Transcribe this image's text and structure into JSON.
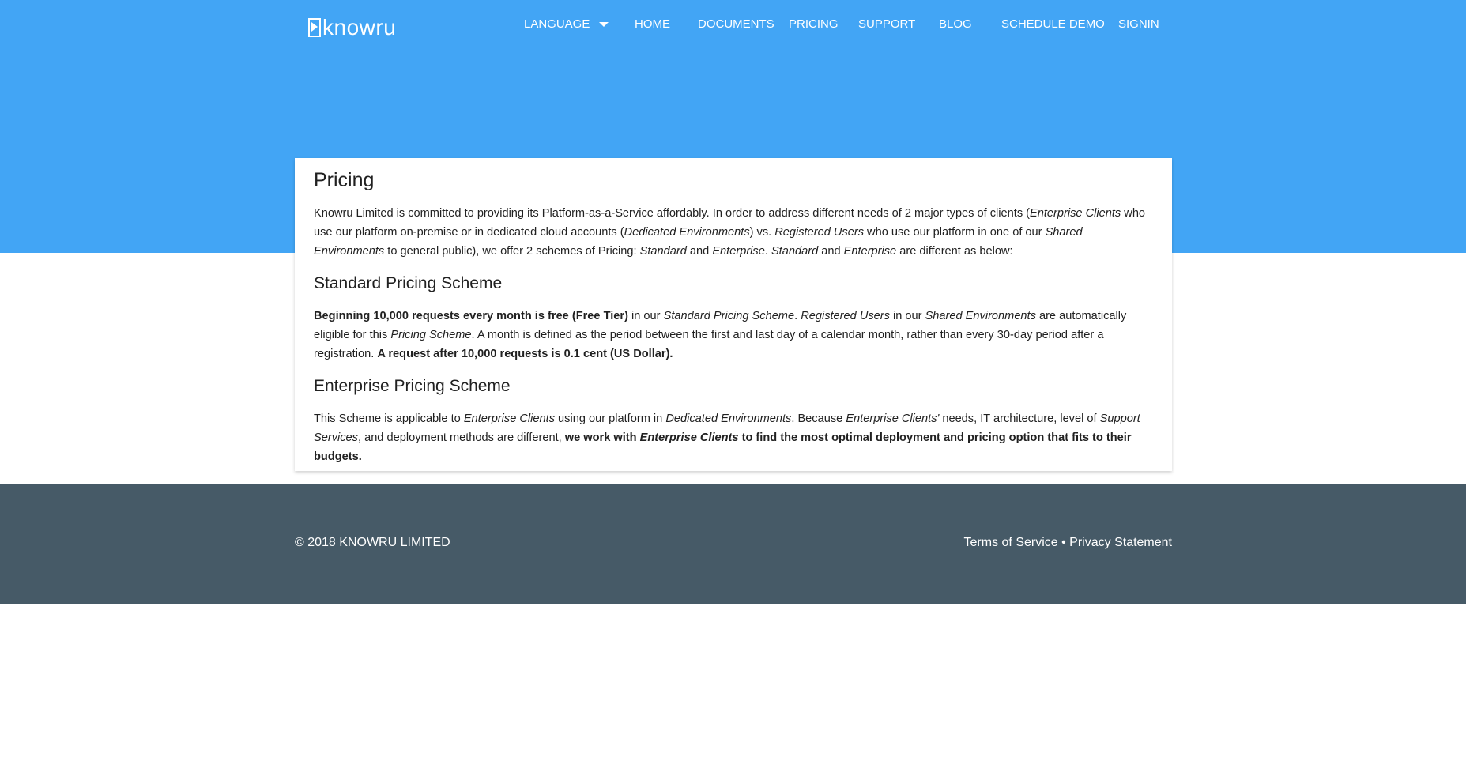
{
  "header": {
    "logo_text": "knowru",
    "nav": {
      "language": "LANGUAGE",
      "home": "HOME",
      "documents": "DOCUMENTS",
      "pricing": "PRICING",
      "support": "SUPPORT",
      "blog": "BLOG",
      "schedule_demo": "SCHEDULE DEMO",
      "signin": "SIGNIN"
    }
  },
  "colors": {
    "hero": "#42a5f5",
    "footer": "#465a67"
  },
  "card": {
    "title": "Pricing",
    "intro": {
      "t1": "Knowru Limited is committed to providing its Platform-as-a-Service affordably. In order to address different needs of 2 major types of clients (",
      "i1": "Enterprise Clients",
      "t2": " who use our platform on-premise or in dedicated cloud accounts (",
      "i2": "Dedicated Environments",
      "t3": ") vs. ",
      "i3": "Registered Users",
      "t4": " who use our platform in one of our ",
      "i4": "Shared Environments",
      "t5": " to general public), we offer 2 schemes of Pricing: ",
      "i5": "Standard",
      "t6": " and ",
      "i6": "Enterprise",
      "t7": ". ",
      "i7": "Standard",
      "t8": " and ",
      "i8": "Enterprise",
      "t9": " are different as below:"
    },
    "standard": {
      "heading": "Standard Pricing Scheme",
      "b1": "Beginning 10,000 requests every month is free (Free Tier)",
      "t1": " in our ",
      "i1": "Standard Pricing Scheme",
      "t2": ". ",
      "i2": "Registered Users",
      "t3": " in our ",
      "i3": "Shared Environments",
      "t4": " are automatically eligible for this ",
      "i4": "Pricing Scheme",
      "t5": ". A month is defined as the period between the first and last day of a calendar month, rather than every 30-day period after a registration. ",
      "b2": "A request after 10,000 requests is 0.1 cent (US Dollar)."
    },
    "enterprise": {
      "heading": "Enterprise Pricing Scheme",
      "t1": "This Scheme is applicable to ",
      "i1": "Enterprise Clients",
      "t2": " using our platform in ",
      "i2": "Dedicated Environments",
      "t3": ". Because ",
      "i3": "Enterprise Clients'",
      "t4": " needs, IT architecture, level of ",
      "i4": "Support Services",
      "t5": ", and deployment methods are different, ",
      "b1": "we work with ",
      "bi1": "Enterprise Clients",
      "b2": " to find the most optimal deployment and pricing option that fits to their budgets."
    }
  },
  "footer": {
    "copyright": "© 2018 KNOWRU LIMITED",
    "terms": "Terms of Service",
    "separator": " • ",
    "privacy": "Privacy Statement"
  }
}
